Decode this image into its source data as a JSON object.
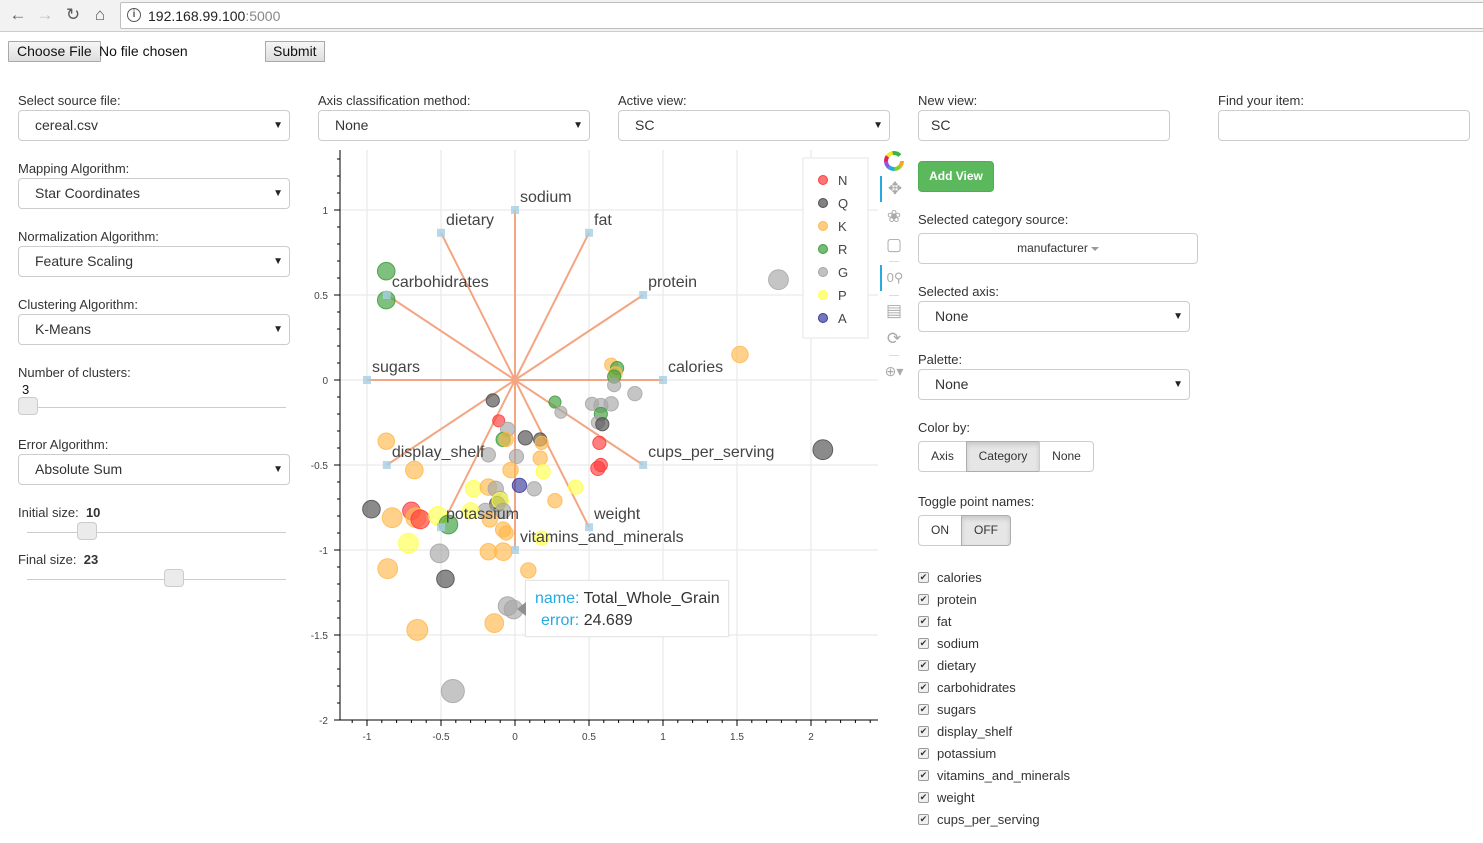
{
  "browser": {
    "url_host": "192.168.99.100",
    "url_port": ":5000",
    "back_icon": "arrow-left",
    "forward_icon": "arrow-right",
    "reload_icon": "reload",
    "home_icon": "home",
    "info_icon": "info"
  },
  "upload": {
    "choose_label": "Choose File",
    "status": "No file chosen",
    "submit_label": "Submit"
  },
  "left": {
    "source_label": "Select source file:",
    "source_value": "cereal.csv",
    "mapping_label": "Mapping Algorithm:",
    "mapping_value": "Star Coordinates",
    "normalization_label": "Normalization Algorithm:",
    "normalization_value": "Feature Scaling",
    "clustering_label": "Clustering Algorithm:",
    "clustering_value": "K-Means",
    "clusters_label": "Number of clusters:",
    "clusters_value": "3",
    "error_label": "Error Algorithm:",
    "error_value": "Absolute Sum",
    "initial_size_label": "Initial size:",
    "initial_size_value": "10",
    "final_size_label": "Final size:",
    "final_size_value": "23"
  },
  "top": {
    "axis_class_label": "Axis classification method:",
    "axis_class_value": "None",
    "active_view_label": "Active view:",
    "active_view_value": "SC"
  },
  "right": {
    "new_view_label": "New view:",
    "new_view_value": "SC",
    "find_label": "Find your item:",
    "find_value": "",
    "add_view_label": "Add View",
    "category_source_label": "Selected category source:",
    "category_source_value": "manufacturer",
    "selected_axis_label": "Selected axis:",
    "selected_axis_value": "None",
    "palette_label": "Palette:",
    "palette_value": "None",
    "color_by_label": "Color by:",
    "color_by_options": [
      "Axis",
      "Category",
      "None"
    ],
    "color_by_selected": "Category",
    "toggle_names_label": "Toggle point names:",
    "toggle_options": [
      "ON",
      "OFF"
    ],
    "toggle_selected": "OFF",
    "axes_checklist": [
      {
        "label": "calories",
        "checked": true
      },
      {
        "label": "protein",
        "checked": true
      },
      {
        "label": "fat",
        "checked": true
      },
      {
        "label": "sodium",
        "checked": true
      },
      {
        "label": "dietary",
        "checked": true
      },
      {
        "label": "carbohidrates",
        "checked": true
      },
      {
        "label": "sugars",
        "checked": true
      },
      {
        "label": "display_shelf",
        "checked": true
      },
      {
        "label": "potassium",
        "checked": true
      },
      {
        "label": "vitamins_and_minerals",
        "checked": true
      },
      {
        "label": "weight",
        "checked": true
      },
      {
        "label": "cups_per_serving",
        "checked": true
      }
    ]
  },
  "toolbar": {
    "tools": [
      "bokeh-logo",
      "pan",
      "lasso-select",
      "box-zoom",
      "wheel-zoom",
      "save",
      "reset",
      "hover"
    ]
  },
  "chart_data": {
    "type": "scatter",
    "title": "",
    "xlabel": "",
    "ylabel": "",
    "xlim": [
      -1.18,
      2.45
    ],
    "ylim": [
      -2.0,
      1.35
    ],
    "xticks": [
      -1,
      -0.5,
      0,
      0.5,
      1,
      1.5,
      2
    ],
    "yticks": [
      1,
      0.5,
      0,
      -0.5,
      -1,
      -1.5,
      -2
    ],
    "grid": true,
    "legend_position": "top-right",
    "categories": [
      {
        "name": "N",
        "color": "#ff3b3b"
      },
      {
        "name": "Q",
        "color": "#4d4d4d"
      },
      {
        "name": "K",
        "color": "#ffb84d"
      },
      {
        "name": "R",
        "color": "#3a9e3a"
      },
      {
        "name": "G",
        "color": "#a6a6a6"
      },
      {
        "name": "P",
        "color": "#ffff4d"
      },
      {
        "name": "A",
        "color": "#3a3a9e"
      }
    ],
    "axes": [
      {
        "name": "sodium",
        "x": 0,
        "y": 1
      },
      {
        "name": "fat",
        "x": 0.5,
        "y": 0.866
      },
      {
        "name": "protein",
        "x": 0.866,
        "y": 0.5
      },
      {
        "name": "calories",
        "x": 1,
        "y": 0
      },
      {
        "name": "cups_per_serving",
        "x": 0.866,
        "y": -0.5
      },
      {
        "name": "weight",
        "x": 0.5,
        "y": -0.866
      },
      {
        "name": "vitamins_and_minerals",
        "x": 0,
        "y": -1
      },
      {
        "name": "potassium",
        "x": -0.5,
        "y": -0.866
      },
      {
        "name": "display_shelf",
        "x": -0.866,
        "y": -0.5
      },
      {
        "name": "sugars",
        "x": -1,
        "y": 0
      },
      {
        "name": "carbohidrates",
        "x": -0.866,
        "y": 0.5
      },
      {
        "name": "dietary",
        "x": -0.5,
        "y": 0.866
      }
    ],
    "points": [
      {
        "x": -0.87,
        "y": 0.64,
        "cat": "R",
        "size": 16
      },
      {
        "x": -0.87,
        "y": 0.47,
        "cat": "R",
        "size": 16
      },
      {
        "x": 1.78,
        "y": 0.59,
        "cat": "G",
        "size": 18
      },
      {
        "x": 1.52,
        "y": 0.15,
        "cat": "K",
        "size": 15
      },
      {
        "x": 0.65,
        "y": 0.09,
        "cat": "K",
        "size": 12
      },
      {
        "x": 0.69,
        "y": 0.07,
        "cat": "R",
        "size": 12
      },
      {
        "x": 0.68,
        "y": 0.04,
        "cat": "K",
        "size": 12
      },
      {
        "x": 0.67,
        "y": 0.02,
        "cat": "R",
        "size": 12
      },
      {
        "x": 0.67,
        "y": -0.03,
        "cat": "G",
        "size": 12
      },
      {
        "x": 0.81,
        "y": -0.08,
        "cat": "G",
        "size": 13
      },
      {
        "x": 0.52,
        "y": -0.14,
        "cat": "G",
        "size": 12
      },
      {
        "x": 0.58,
        "y": -0.15,
        "cat": "G",
        "size": 13
      },
      {
        "x": 0.65,
        "y": -0.14,
        "cat": "G",
        "size": 13
      },
      {
        "x": 0.58,
        "y": -0.2,
        "cat": "R",
        "size": 12
      },
      {
        "x": 0.56,
        "y": -0.25,
        "cat": "G",
        "size": 12
      },
      {
        "x": 0.59,
        "y": -0.26,
        "cat": "Q",
        "size": 12
      },
      {
        "x": 0.27,
        "y": -0.13,
        "cat": "R",
        "size": 11
      },
      {
        "x": 0.31,
        "y": -0.19,
        "cat": "G",
        "size": 11
      },
      {
        "x": 0.57,
        "y": -0.37,
        "cat": "N",
        "size": 12
      },
      {
        "x": 0.56,
        "y": -0.52,
        "cat": "N",
        "size": 13
      },
      {
        "x": 0.58,
        "y": -0.5,
        "cat": "N",
        "size": 12
      },
      {
        "x": 2.08,
        "y": -0.41,
        "cat": "Q",
        "size": 18
      },
      {
        "x": -0.15,
        "y": -0.12,
        "cat": "Q",
        "size": 12
      },
      {
        "x": -0.11,
        "y": -0.24,
        "cat": "N",
        "size": 11
      },
      {
        "x": -0.05,
        "y": -0.29,
        "cat": "G",
        "size": 13
      },
      {
        "x": -0.08,
        "y": -0.35,
        "cat": "R",
        "size": 13
      },
      {
        "x": -0.06,
        "y": -0.35,
        "cat": "K",
        "size": 13
      },
      {
        "x": 0.07,
        "y": -0.34,
        "cat": "Q",
        "size": 13
      },
      {
        "x": 0.17,
        "y": -0.35,
        "cat": "Q",
        "size": 12
      },
      {
        "x": 0.18,
        "y": -0.37,
        "cat": "K",
        "size": 12
      },
      {
        "x": 0.17,
        "y": -0.46,
        "cat": "K",
        "size": 13
      },
      {
        "x": -0.18,
        "y": -0.44,
        "cat": "G",
        "size": 13
      },
      {
        "x": 0.01,
        "y": -0.45,
        "cat": "G",
        "size": 13
      },
      {
        "x": -0.87,
        "y": -0.36,
        "cat": "K",
        "size": 15
      },
      {
        "x": -0.68,
        "y": -0.53,
        "cat": "K",
        "size": 16
      },
      {
        "x": -0.03,
        "y": -0.53,
        "cat": "K",
        "size": 14
      },
      {
        "x": 0.19,
        "y": -0.54,
        "cat": "P",
        "size": 13
      },
      {
        "x": 0.41,
        "y": -0.63,
        "cat": "P",
        "size": 13
      },
      {
        "x": 0.03,
        "y": -0.62,
        "cat": "A",
        "size": 13
      },
      {
        "x": 0.13,
        "y": -0.64,
        "cat": "G",
        "size": 13
      },
      {
        "x": 0.27,
        "y": -0.71,
        "cat": "K",
        "size": 13
      },
      {
        "x": -0.28,
        "y": -0.64,
        "cat": "P",
        "size": 15
      },
      {
        "x": -0.18,
        "y": -0.63,
        "cat": "K",
        "size": 15
      },
      {
        "x": -0.13,
        "y": -0.64,
        "cat": "G",
        "size": 14
      },
      {
        "x": -0.1,
        "y": -0.7,
        "cat": "G",
        "size": 14
      },
      {
        "x": -0.12,
        "y": -0.73,
        "cat": "Q",
        "size": 14
      },
      {
        "x": -0.1,
        "y": -0.71,
        "cat": "P",
        "size": 15
      },
      {
        "x": -0.2,
        "y": -0.77,
        "cat": "G",
        "size": 14
      },
      {
        "x": -0.08,
        "y": -0.77,
        "cat": "G",
        "size": 14
      },
      {
        "x": -0.3,
        "y": -0.77,
        "cat": "P",
        "size": 15
      },
      {
        "x": -0.17,
        "y": -0.82,
        "cat": "K",
        "size": 14
      },
      {
        "x": -0.08,
        "y": -0.88,
        "cat": "K",
        "size": 14
      },
      {
        "x": -0.06,
        "y": -0.9,
        "cat": "K",
        "size": 13
      },
      {
        "x": 0.18,
        "y": -0.93,
        "cat": "P",
        "size": 13
      },
      {
        "x": -0.97,
        "y": -0.76,
        "cat": "Q",
        "size": 16
      },
      {
        "x": -0.83,
        "y": -0.81,
        "cat": "K",
        "size": 18
      },
      {
        "x": -0.7,
        "y": -0.77,
        "cat": "N",
        "size": 16
      },
      {
        "x": -0.67,
        "y": -0.81,
        "cat": "K",
        "size": 18
      },
      {
        "x": -0.64,
        "y": -0.82,
        "cat": "N",
        "size": 17
      },
      {
        "x": -0.52,
        "y": -0.8,
        "cat": "P",
        "size": 17
      },
      {
        "x": -0.45,
        "y": -0.85,
        "cat": "R",
        "size": 17
      },
      {
        "x": -0.72,
        "y": -0.96,
        "cat": "P",
        "size": 18
      },
      {
        "x": -0.51,
        "y": -1.02,
        "cat": "G",
        "size": 17
      },
      {
        "x": -0.86,
        "y": -1.11,
        "cat": "K",
        "size": 18
      },
      {
        "x": -0.47,
        "y": -1.17,
        "cat": "Q",
        "size": 16
      },
      {
        "x": -0.18,
        "y": -1.01,
        "cat": "K",
        "size": 15
      },
      {
        "x": -0.08,
        "y": -1.01,
        "cat": "K",
        "size": 16
      },
      {
        "x": 0.09,
        "y": -1.12,
        "cat": "K",
        "size": 14
      },
      {
        "x": -0.05,
        "y": -1.33,
        "cat": "G",
        "size": 17
      },
      {
        "x": -0.01,
        "y": -1.35,
        "cat": "G",
        "size": 17
      },
      {
        "x": -0.14,
        "y": -1.43,
        "cat": "K",
        "size": 17
      },
      {
        "x": -0.66,
        "y": -1.47,
        "cat": "K",
        "size": 19
      },
      {
        "x": -0.42,
        "y": -1.83,
        "cat": "G",
        "size": 21
      }
    ],
    "tooltip": {
      "name_key": "name:",
      "name_value": "Total_Whole_Grain",
      "error_key": "error:",
      "error_value": "24.689"
    }
  }
}
